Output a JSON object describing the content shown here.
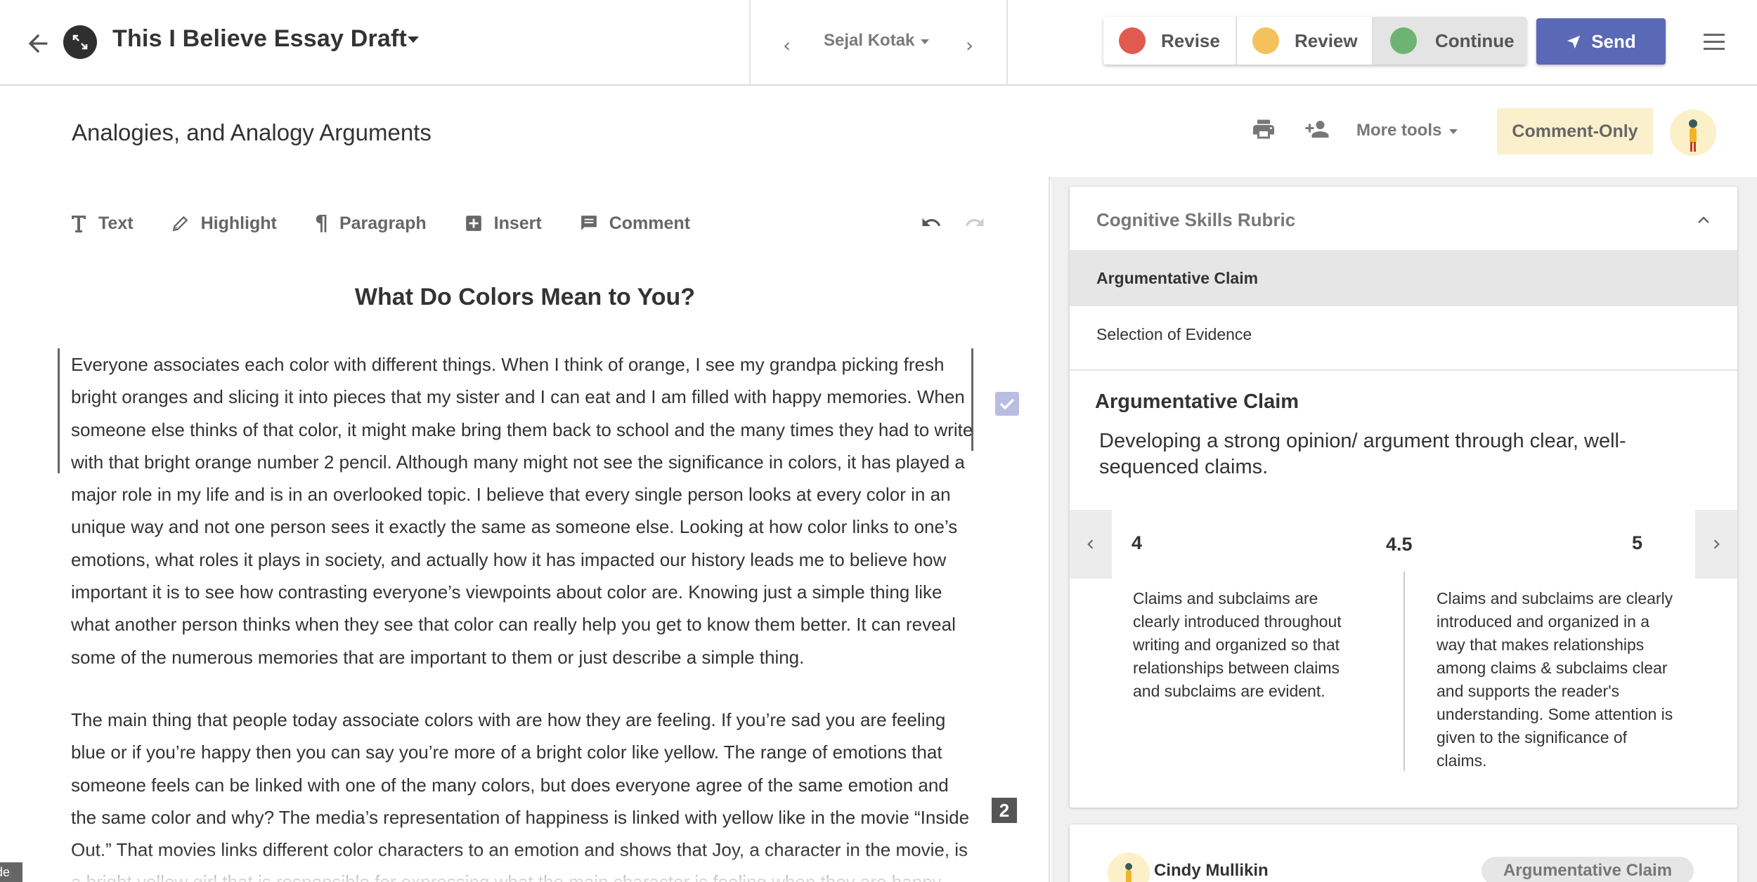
{
  "header": {
    "doc_title": "This I Believe Essay Draft",
    "student": "Sejal Kotak",
    "status_buttons": [
      {
        "label": "Revise",
        "color": "#e05a4f"
      },
      {
        "label": "Review",
        "color": "#f5c15c"
      },
      {
        "label": "Continue",
        "color": "#6fb374"
      }
    ],
    "send_label": "Send"
  },
  "subheader": {
    "assignment_title": "Analogies, and Analogy Arguments",
    "more_tools": "More tools",
    "comment_only": "Comment-Only"
  },
  "toolbar": {
    "items": [
      {
        "label": "Text",
        "icon": "text-icon"
      },
      {
        "label": "Highlight",
        "icon": "pen-icon"
      },
      {
        "label": "Paragraph",
        "icon": "pilcrow-icon"
      },
      {
        "label": "Insert",
        "icon": "plus-box-icon"
      },
      {
        "label": "Comment",
        "icon": "comment-icon"
      }
    ]
  },
  "essay": {
    "title": "What Do Colors Mean to You?",
    "paragraphs": [
      "Everyone associates each color with different things. When I think of orange, I see my grandpa picking fresh bright oranges and slicing it into pieces that my sister and I can eat and I am filled with happy memories. When someone else thinks of that color, it might make bring them back to school and the many times they had to write with that bright orange number 2 pencil. Although many might not see the significance in colors, it has played a major role in my life and is in an overlooked topic. I believe that every single person looks at every color in an unique way and not one person sees it exactly the same as someone else. Looking at how color links to one’s emotions, what roles it plays in society, and actually how it has impacted our history leads me to believe how important it is to see how contrasting everyone’s viewpoints about color are. Knowing just a simple thing like what another person thinks when they see that color can really help you get to know them better. It can reveal some of the numerous memories that are important to them or just describe a simple thing.",
      "The main thing that people today associate colors with are how they are feeling. If you’re sad you are feeling blue or if you’re happy then you can say you’re more of a bright color like yellow. The range of emotions that someone feels can be linked with one of the many colors, but does everyone agree of the same emotion and the same color and why? The media’s representation of happiness is linked with yellow like in the movie “Inside Out.” That movies links different color characters to an emotion and shows that Joy, a character in the movie, is a bright yellow girl that is responsible for expressing what the main character is feeling when they are happy."
    ],
    "paragraph_number": "2",
    "corner_tab": "de"
  },
  "rubric": {
    "title": "Cognitive Skills Rubric",
    "criteria": [
      "Argumentative Claim",
      "Selection of Evidence"
    ],
    "selected_title": "Argumentative Claim",
    "selected_desc": "Developing a strong opinion/ argument through clear, well-sequenced claims.",
    "scores": [
      {
        "label": "4",
        "text": "Claims and subclaims are clearly introduced throughout writing and organized so that relationships between claims and subclaims are evident."
      },
      {
        "label": "4.5",
        "text": ""
      },
      {
        "label": "5",
        "text": "Claims and subclaims are clearly introduced and organized in a way that makes relationships among claims & subclaims clear and supports the reader's understanding. Some attention is given to the significance of claims."
      }
    ]
  },
  "comment": {
    "author": "Cindy Mullikin",
    "tag": "Argumentative Claim"
  }
}
